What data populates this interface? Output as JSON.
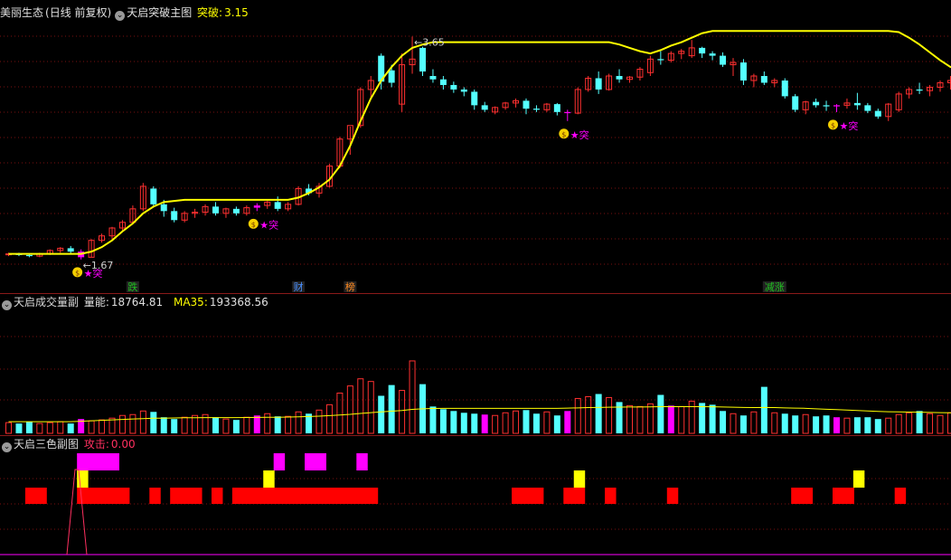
{
  "panel_main": {
    "stock_name": "美丽生态",
    "period": "(日线 前复权)",
    "indicator": "天启突破主图",
    "value_label": "突破:",
    "value": "3.15",
    "high_label": "3.65",
    "low_label": "1.67",
    "signal_text": "突",
    "event_labels": [
      {
        "text": "跌",
        "color": "#20c020"
      },
      {
        "text": "财",
        "color": "#4a90ff"
      },
      {
        "text": "榜",
        "color": "#ff8a20"
      },
      {
        "text": "减涨",
        "color": "#20c020"
      }
    ]
  },
  "panel_volume": {
    "indicator": "天启成交量副",
    "value_label": "量能:",
    "value": "18764.81",
    "ma_label": "MA35:",
    "ma_value": "193368.56"
  },
  "panel_color": {
    "indicator": "天启三色副图",
    "value_label": "攻击:",
    "value": "0.00"
  },
  "colors": {
    "up": "#ff3030",
    "down": "#54ffff",
    "signal": "#ff00ff",
    "line": "#ffff00",
    "grid": "#7a1010",
    "red_bar": "#ff0000",
    "yellow_bar": "#ffff00"
  },
  "chart_data": {
    "type": "candlestick",
    "series": [
      {
        "name": "K线",
        "ohlc": [
          [
            1.72,
            1.73,
            1.7,
            1.72
          ],
          [
            1.72,
            1.73,
            1.7,
            1.71
          ],
          [
            1.71,
            1.72,
            1.69,
            1.7
          ],
          [
            1.7,
            1.73,
            1.69,
            1.72
          ],
          [
            1.72,
            1.76,
            1.71,
            1.75
          ],
          [
            1.75,
            1.78,
            1.73,
            1.77
          ],
          [
            1.77,
            1.79,
            1.72,
            1.74
          ],
          [
            1.74,
            1.76,
            1.67,
            1.69
          ],
          [
            1.69,
            1.85,
            1.69,
            1.84
          ],
          [
            1.84,
            1.9,
            1.82,
            1.88
          ],
          [
            1.88,
            1.96,
            1.85,
            1.95
          ],
          [
            1.95,
            2.02,
            1.93,
            2.0
          ],
          [
            2.0,
            2.15,
            1.99,
            2.12
          ],
          [
            2.12,
            2.35,
            2.1,
            2.32
          ],
          [
            2.3,
            2.32,
            2.14,
            2.16
          ],
          [
            2.16,
            2.2,
            2.05,
            2.1
          ],
          [
            2.1,
            2.13,
            2.0,
            2.02
          ],
          [
            2.02,
            2.1,
            2.0,
            2.08
          ],
          [
            2.08,
            2.12,
            2.04,
            2.09
          ],
          [
            2.09,
            2.16,
            2.06,
            2.14
          ],
          [
            2.14,
            2.18,
            2.06,
            2.08
          ],
          [
            2.08,
            2.13,
            2.04,
            2.12
          ],
          [
            2.12,
            2.14,
            2.06,
            2.08
          ],
          [
            2.08,
            2.15,
            2.06,
            2.13
          ],
          [
            2.13,
            2.17,
            2.1,
            2.15
          ],
          [
            2.15,
            2.19,
            2.12,
            2.18
          ],
          [
            2.18,
            2.23,
            2.1,
            2.12
          ],
          [
            2.12,
            2.18,
            2.1,
            2.16
          ],
          [
            2.16,
            2.32,
            2.15,
            2.3
          ],
          [
            2.3,
            2.34,
            2.24,
            2.26
          ],
          [
            2.26,
            2.35,
            2.22,
            2.32
          ],
          [
            2.32,
            2.52,
            2.31,
            2.5
          ],
          [
            2.5,
            2.76,
            2.48,
            2.74
          ],
          [
            2.74,
            2.85,
            2.6,
            2.86
          ],
          [
            2.86,
            3.2,
            2.84,
            3.18
          ],
          [
            3.18,
            3.3,
            3.1,
            3.26
          ],
          [
            3.48,
            3.5,
            3.18,
            3.25
          ],
          [
            3.35,
            3.4,
            3.2,
            3.24
          ],
          [
            3.05,
            3.5,
            2.98,
            3.4
          ],
          [
            3.4,
            3.65,
            3.32,
            3.45
          ],
          [
            3.55,
            3.56,
            3.3,
            3.34
          ],
          [
            3.3,
            3.36,
            3.24,
            3.27
          ],
          [
            3.27,
            3.3,
            3.18,
            3.22
          ],
          [
            3.22,
            3.25,
            3.15,
            3.18
          ],
          [
            3.18,
            3.2,
            3.12,
            3.16
          ],
          [
            3.16,
            3.18,
            3.0,
            3.04
          ],
          [
            3.04,
            3.07,
            2.98,
            3.0
          ],
          [
            2.98,
            3.03,
            2.96,
            3.02
          ],
          [
            3.02,
            3.07,
            3.0,
            3.06
          ],
          [
            3.06,
            3.1,
            3.02,
            3.08
          ],
          [
            3.08,
            3.1,
            2.96,
            3.01
          ],
          [
            3.01,
            3.04,
            2.98,
            3.0
          ],
          [
            3.0,
            3.06,
            2.98,
            3.05
          ],
          [
            3.05,
            3.06,
            2.95,
            2.98
          ],
          [
            2.98,
            3.0,
            2.9,
            2.97
          ],
          [
            2.97,
            3.2,
            2.96,
            3.18
          ],
          [
            3.18,
            3.3,
            3.16,
            3.28
          ],
          [
            3.28,
            3.34,
            3.14,
            3.18
          ],
          [
            3.18,
            3.32,
            3.17,
            3.3
          ],
          [
            3.3,
            3.36,
            3.24,
            3.27
          ],
          [
            3.27,
            3.3,
            3.24,
            3.29
          ],
          [
            3.29,
            3.38,
            3.26,
            3.36
          ],
          [
            3.33,
            3.48,
            3.3,
            3.45
          ],
          [
            3.45,
            3.52,
            3.4,
            3.44
          ],
          [
            3.44,
            3.52,
            3.42,
            3.5
          ],
          [
            3.5,
            3.54,
            3.45,
            3.52
          ],
          [
            3.48,
            3.62,
            3.46,
            3.55
          ],
          [
            3.55,
            3.56,
            3.46,
            3.5
          ],
          [
            3.5,
            3.52,
            3.44,
            3.48
          ],
          [
            3.48,
            3.51,
            3.38,
            3.4
          ],
          [
            3.4,
            3.46,
            3.3,
            3.42
          ],
          [
            3.42,
            3.45,
            3.22,
            3.26
          ],
          [
            3.26,
            3.32,
            3.2,
            3.3
          ],
          [
            3.3,
            3.34,
            3.22,
            3.24
          ],
          [
            3.24,
            3.28,
            3.2,
            3.26
          ],
          [
            3.26,
            3.28,
            3.1,
            3.12
          ],
          [
            3.12,
            3.14,
            2.98,
            3.0
          ],
          [
            3.0,
            3.08,
            2.96,
            3.07
          ],
          [
            3.07,
            3.1,
            3.02,
            3.04
          ],
          [
            3.04,
            3.08,
            2.99,
            3.03
          ],
          [
            3.03,
            3.05,
            2.98,
            3.04
          ],
          [
            3.04,
            3.1,
            3.01,
            3.06
          ],
          [
            3.06,
            3.15,
            3.0,
            3.04
          ],
          [
            3.04,
            3.06,
            2.97,
            2.99
          ],
          [
            2.99,
            3.01,
            2.92,
            2.94
          ],
          [
            2.94,
            3.06,
            2.9,
            3.05
          ],
          [
            3.0,
            3.16,
            2.98,
            3.14
          ],
          [
            3.14,
            3.2,
            3.1,
            3.18
          ],
          [
            3.18,
            3.24,
            3.14,
            3.17
          ],
          [
            3.17,
            3.22,
            3.12,
            3.2
          ],
          [
            3.2,
            3.26,
            3.16,
            3.24
          ],
          [
            3.24,
            3.3,
            3.18,
            3.26
          ],
          [
            3.26,
            3.32,
            3.2,
            3.22
          ],
          [
            3.22,
            3.3,
            3.2,
            3.26
          ],
          [
            3.26,
            3.28,
            3.18,
            3.2
          ],
          [
            3.2,
            3.24,
            3.16,
            3.2
          ],
          [
            3.2,
            3.24,
            3.15,
            3.18
          ],
          [
            3.18,
            3.2,
            3.08,
            3.12
          ],
          [
            3.12,
            3.15,
            3.08,
            3.1
          ],
          [
            3.1,
            3.12,
            3.06,
            3.09
          ],
          [
            3.09,
            3.11,
            3.07,
            3.08
          ]
        ]
      }
    ],
    "breakout_line": [
      1.72,
      1.72,
      1.72,
      1.72,
      1.72,
      1.72,
      1.72,
      1.72,
      1.74,
      1.78,
      1.84,
      1.92,
      1.99,
      2.08,
      2.14,
      2.18,
      2.19,
      2.2,
      2.2,
      2.2,
      2.2,
      2.2,
      2.2,
      2.2,
      2.2,
      2.2,
      2.2,
      2.2,
      2.22,
      2.26,
      2.31,
      2.38,
      2.5,
      2.68,
      2.9,
      3.1,
      3.26,
      3.38,
      3.48,
      3.55,
      3.58,
      3.6,
      3.6,
      3.6,
      3.6,
      3.6,
      3.6,
      3.6,
      3.6,
      3.6,
      3.6,
      3.6,
      3.6,
      3.6,
      3.6,
      3.6,
      3.6,
      3.6,
      3.6,
      3.58,
      3.55,
      3.52,
      3.5,
      3.53,
      3.57,
      3.6,
      3.64,
      3.68,
      3.7,
      3.7,
      3.7,
      3.7,
      3.7,
      3.7,
      3.7,
      3.7,
      3.7,
      3.7,
      3.7,
      3.7,
      3.7,
      3.7,
      3.7,
      3.7,
      3.7,
      3.7,
      3.69,
      3.64,
      3.58,
      3.51,
      3.44,
      3.38,
      3.36,
      3.36,
      3.36,
      3.36,
      3.36,
      3.36,
      3.36,
      3.36,
      3.36
    ],
    "signal_bars": [
      7,
      24,
      54,
      80
    ],
    "event_bars": [
      12,
      28,
      33,
      74
    ],
    "volume": [
      1.2,
      1.1,
      1.3,
      1.1,
      1.2,
      1.3,
      1.1,
      1.6,
      1.4,
      1.5,
      1.7,
      2.0,
      2.1,
      2.5,
      2.4,
      1.8,
      1.6,
      1.8,
      2.0,
      2.1,
      1.8,
      1.6,
      1.5,
      1.8,
      2.0,
      2.2,
      1.9,
      1.9,
      2.4,
      2.2,
      2.6,
      3.2,
      4.5,
      5.3,
      6.1,
      5.8,
      4.2,
      5.4,
      4.8,
      8.1,
      5.5,
      3.0,
      2.7,
      2.5,
      2.3,
      2.2,
      2.1,
      2.0,
      2.3,
      2.5,
      2.6,
      2.2,
      2.4,
      2.0,
      2.5,
      3.9,
      4.1,
      4.4,
      4.0,
      3.5,
      3.1,
      3.0,
      3.3,
      4.3,
      3.1,
      3.0,
      3.6,
      3.4,
      3.2,
      2.5,
      2.2,
      2.0,
      2.4,
      5.2,
      2.3,
      2.2,
      2.0,
      2.1,
      1.9,
      2.0,
      1.8,
      1.7,
      1.8,
      1.8,
      1.6,
      1.7,
      2.1,
      2.3,
      2.5,
      2.2,
      2.0,
      2.3,
      2.2,
      2.4,
      2.0,
      1.9,
      1.6,
      1.5,
      1.4,
      1.3,
      1.2
    ],
    "volume_ma": [
      1.3,
      1.3,
      1.3,
      1.3,
      1.3,
      1.3,
      1.3,
      1.35,
      1.4,
      1.45,
      1.5,
      1.55,
      1.6,
      1.65,
      1.7,
      1.7,
      1.72,
      1.74,
      1.75,
      1.76,
      1.76,
      1.76,
      1.76,
      1.77,
      1.78,
      1.8,
      1.8,
      1.82,
      1.85,
      1.88,
      1.92,
      1.98,
      2.05,
      2.12,
      2.22,
      2.32,
      2.4,
      2.48,
      2.55,
      2.68,
      2.75,
      2.78,
      2.8,
      2.8,
      2.8,
      2.8,
      2.8,
      2.8,
      2.8,
      2.8,
      2.8,
      2.8,
      2.8,
      2.8,
      2.82,
      2.85,
      2.88,
      2.9,
      2.92,
      2.94,
      2.95,
      2.95,
      2.96,
      2.98,
      2.98,
      2.98,
      2.98,
      2.98,
      2.97,
      2.95,
      2.92,
      2.9,
      2.88,
      2.9,
      2.88,
      2.85,
      2.82,
      2.8,
      2.75,
      2.7,
      2.65,
      2.6,
      2.55,
      2.5,
      2.45,
      2.42,
      2.4,
      2.38,
      2.36,
      2.34,
      2.32,
      2.3,
      2.28,
      2.26,
      2.22,
      2.18,
      2.14,
      2.1,
      2.06,
      2.02,
      2.0
    ],
    "attack_value": 0.0
  }
}
